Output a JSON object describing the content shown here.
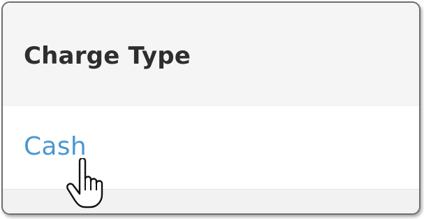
{
  "table": {
    "header": {
      "label": "Charge Type"
    },
    "rows": [
      {
        "value": "Cash"
      }
    ]
  },
  "cursor": {
    "icon": "hand-pointer-icon"
  },
  "colors": {
    "link": "#4a97cf",
    "header_text": "#2e2e2e",
    "header_bg": "#f5f5f5",
    "frame_border": "#6f6f6f"
  }
}
